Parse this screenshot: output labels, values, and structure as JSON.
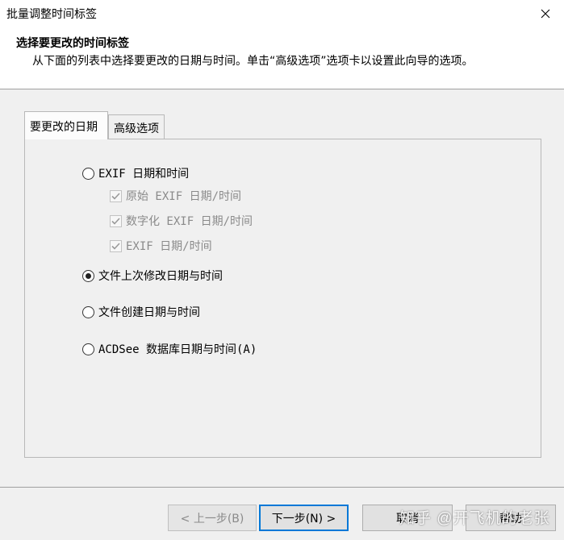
{
  "window": {
    "title": "批量调整时间标签"
  },
  "header": {
    "title": "选择要更改的时间标签",
    "subtitle": "从下面的列表中选择要更改的日期与时间。单击“高级选项”选项卡以设置此向导的选项。"
  },
  "tabs": [
    {
      "label": "要更改的日期",
      "active": true
    },
    {
      "label": "高级选项",
      "active": false
    }
  ],
  "options": {
    "exif": {
      "label": "EXIF 日期和时间",
      "selected": false
    },
    "exif_sub": [
      {
        "label": "原始 EXIF 日期/时间",
        "checked": true,
        "enabled": false
      },
      {
        "label": "数字化 EXIF 日期/时间",
        "checked": true,
        "enabled": false
      },
      {
        "label": "EXIF 日期/时间",
        "checked": true,
        "enabled": false
      }
    ],
    "modified": {
      "label": "文件上次修改日期与时间",
      "selected": true
    },
    "created": {
      "label": "文件创建日期与时间",
      "selected": false
    },
    "acdsee": {
      "label": "ACDSee 数据库日期与时间(A)",
      "selected": false
    }
  },
  "buttons": {
    "back": "< 上一步(B)",
    "next": "下一步(N) >",
    "cancel": "取消",
    "help": "帮助"
  },
  "watermark": "知乎 @开飞机的老张",
  "colors": {
    "accent": "#0078d7",
    "background": "#f0f0f0"
  },
  "icons": {
    "close": "close-icon",
    "checkmark": "checkmark-icon"
  }
}
